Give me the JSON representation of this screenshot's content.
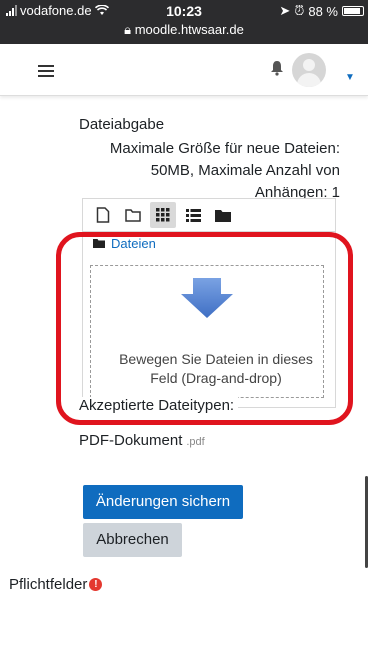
{
  "status_bar": {
    "carrier": "vodafone.de",
    "time": "10:23",
    "url": "moodle.htwsaar.de",
    "battery": "88 %"
  },
  "navbar": {
    "menu_icon": "hamburger-icon",
    "notification_icon": "bell-icon",
    "user_icon": "avatar-icon"
  },
  "form": {
    "label": "Dateiabgabe",
    "constraint_line1": "Maximale Größe für neue Dateien:",
    "constraint_line2": "50MB, Maximale Anzahl von",
    "constraint_line3": "Anhängen: 1",
    "toolbar_icons": [
      "add-file-icon",
      "create-folder-icon",
      "grid-view-icon",
      "list-view-icon",
      "tree-view-icon"
    ],
    "breadcrumb": "Dateien",
    "drop_text_line1": "Bewegen Sie Dateien in dieses",
    "drop_text_line2": "Feld (Drag-and-drop)",
    "accepted_label": "Akzeptierte Dateitypen:",
    "accepted_type": "PDF-Dokument",
    "accepted_ext": ".pdf",
    "save_label": "Änderungen sichern",
    "cancel_label": "Abbrechen",
    "required_label": "Pflichtfelder"
  },
  "colors": {
    "primary": "#0f6cbf",
    "highlight_outline": "#e0141e",
    "required_icon": "#e4382f",
    "drop_arrow": "#4a7bd0"
  }
}
